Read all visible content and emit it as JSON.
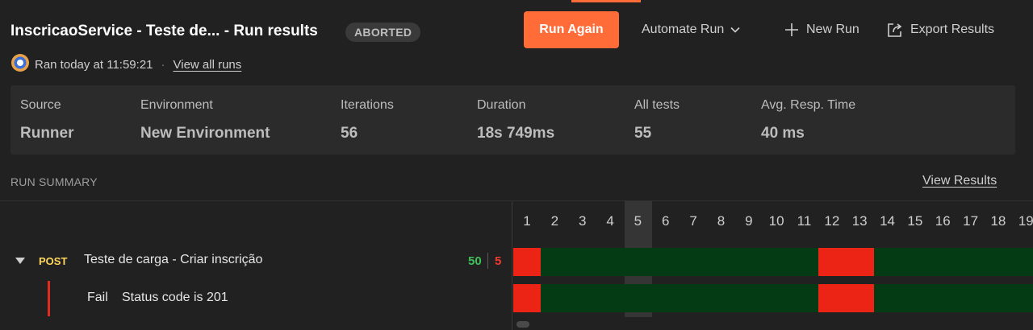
{
  "header": {
    "title": "InscricaoService - Teste de... - Run results",
    "status_badge": "ABORTED",
    "run_again_label": "Run Again",
    "automate_run_label": "Automate Run",
    "new_run_label": "New Run",
    "export_results_label": "Export Results"
  },
  "meta": {
    "ran_text": "Ran today at 11:59:21",
    "separator": "·",
    "view_all_runs_label": "View all runs"
  },
  "stats": [
    {
      "label": "Source",
      "value": "Runner"
    },
    {
      "label": "Environment",
      "value": "New Environment"
    },
    {
      "label": "Iterations",
      "value": "56"
    },
    {
      "label": "Duration",
      "value": "18s 749ms"
    },
    {
      "label": "All tests",
      "value": "55"
    },
    {
      "label": "Avg. Resp. Time",
      "value": "40 ms"
    }
  ],
  "run_summary": {
    "label": "RUN SUMMARY",
    "view_results_label": "View Results",
    "iteration_numbers": [
      "1",
      "2",
      "3",
      "4",
      "5",
      "6",
      "7",
      "8",
      "9",
      "10",
      "11",
      "12",
      "13",
      "14",
      "15",
      "16",
      "17",
      "18",
      "19"
    ],
    "selected_iteration": "5",
    "request": {
      "method": "POST",
      "name": "Teste de carga - Criar inscrição",
      "pass_count": "50",
      "fail_count": "5",
      "test": {
        "status": "Fail",
        "name": "Status code is 201"
      }
    },
    "results": [
      "fail",
      "pass",
      "pass",
      "pass",
      "pass",
      "pass",
      "pass",
      "pass",
      "pass",
      "pass",
      "pass",
      "fail",
      "fail",
      "pass",
      "pass",
      "pass",
      "pass",
      "pass",
      "pass"
    ]
  },
  "colors": {
    "accent": "#ff6c37",
    "pass_cell": "#053b14",
    "fail_cell": "#ec2415",
    "pass_text": "#3fbf5a",
    "fail_text": "#f03a2e",
    "method_post": "#ffd75f"
  },
  "icons": {
    "avatar": "runner-avatar-icon",
    "automate_chevron": "chevron-down-icon",
    "new_run": "plus-icon",
    "export": "export-icon",
    "expand": "caret-down-icon"
  }
}
